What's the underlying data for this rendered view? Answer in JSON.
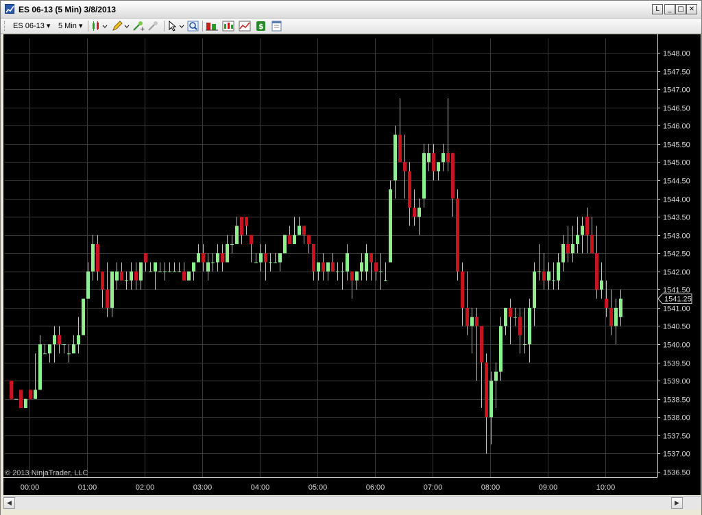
{
  "window": {
    "title": "ES 06-13 (5 Min)  3/8/2013",
    "buttons": {
      "link": "L",
      "minimize": "_",
      "maximize": "□",
      "close": "✕"
    }
  },
  "toolbar": {
    "instrument": "ES 06-13",
    "interval": "5 Min",
    "icons": [
      "bar-type-icon",
      "drawing-pencil-icon",
      "zoom-in-icon",
      "zoom-out-icon",
      "cursor-pointer-icon",
      "magnifier-icon",
      "data-box-icon",
      "indicators-icon",
      "strategies-icon",
      "dollar-icon",
      "properties-icon"
    ]
  },
  "chart": {
    "copyright": "© 2013 NinjaTrader, LLC",
    "current_price_label": "1541.25",
    "colors": {
      "background": "#000000",
      "grid": "#3a3a3a",
      "up": "#90ee90",
      "down": "#c8141e",
      "wick": "#c0c0c0",
      "axis_text": "#dcdcdc"
    }
  },
  "chart_data": {
    "type": "candlestick",
    "instrument": "ES 06-13",
    "interval": "5 Min",
    "date": "3/8/2013",
    "y_ticks": [
      "1536.50",
      "1537.00",
      "1537.50",
      "1538.00",
      "1538.50",
      "1539.00",
      "1539.50",
      "1540.00",
      "1540.50",
      "1541.00",
      "1541.50",
      "1542.00",
      "1542.50",
      "1543.00",
      "1543.50",
      "1544.00",
      "1544.50",
      "1545.00",
      "1545.50",
      "1546.00",
      "1546.50",
      "1547.00",
      "1547.50",
      "1548.00"
    ],
    "ylim": [
      1536.25,
      1548.25
    ],
    "x_ticks": [
      "00:00",
      "01:00",
      "02:00",
      "03:00",
      "04:00",
      "05:00",
      "06:00",
      "07:00",
      "08:00",
      "09:00",
      "10:00"
    ],
    "current_price": 1541.25,
    "candles": [
      [
        1539.0,
        1539.0,
        1538.5,
        1538.5
      ],
      [
        1538.5,
        1538.5,
        1538.5,
        1538.5
      ],
      [
        1538.75,
        1538.75,
        1538.25,
        1538.25
      ],
      [
        1538.25,
        1538.5,
        1538.25,
        1538.5
      ],
      [
        1538.75,
        1538.75,
        1538.5,
        1538.5
      ],
      [
        1538.5,
        1539.75,
        1538.5,
        1538.75
      ],
      [
        1538.75,
        1540.25,
        1538.75,
        1540.0
      ],
      [
        1539.75,
        1540.0,
        1539.75,
        1539.75
      ],
      [
        1539.75,
        1540.0,
        1539.5,
        1540.0
      ],
      [
        1540.0,
        1540.5,
        1539.5,
        1540.25
      ],
      [
        1540.25,
        1540.5,
        1539.75,
        1540.0
      ],
      [
        1540.0,
        1540.0,
        1539.75,
        1540.0
      ],
      [
        1539.75,
        1540.0,
        1539.5,
        1539.75
      ],
      [
        1539.75,
        1540.25,
        1539.75,
        1540.0
      ],
      [
        1540.0,
        1540.75,
        1539.75,
        1540.25
      ],
      [
        1540.25,
        1541.25,
        1540.25,
        1541.25
      ],
      [
        1541.25,
        1542.25,
        1541.25,
        1542.0
      ],
      [
        1542.0,
        1543.0,
        1541.75,
        1542.75
      ],
      [
        1542.75,
        1543.0,
        1541.75,
        1542.0
      ],
      [
        1542.0,
        1542.0,
        1541.0,
        1541.5
      ],
      [
        1541.5,
        1542.25,
        1540.75,
        1541.0
      ],
      [
        1541.0,
        1541.75,
        1540.75,
        1542.0
      ],
      [
        1541.75,
        1542.25,
        1541.5,
        1542.0
      ],
      [
        1542.0,
        1542.25,
        1541.75,
        1541.75
      ],
      [
        1541.75,
        1542.0,
        1541.5,
        1541.75
      ],
      [
        1541.75,
        1542.25,
        1541.5,
        1542.0
      ],
      [
        1542.0,
        1542.25,
        1541.5,
        1541.75
      ],
      [
        1541.75,
        1542.25,
        1541.5,
        1542.25
      ],
      [
        1542.5,
        1542.5,
        1542.0,
        1542.25
      ],
      [
        1542.0,
        1542.25,
        1542.0,
        1542.0
      ],
      [
        1542.0,
        1542.25,
        1541.5,
        1542.25
      ],
      [
        1542.0,
        1542.25,
        1542.0,
        1542.0
      ],
      [
        1542.0,
        1542.25,
        1541.75,
        1542.0
      ],
      [
        1542.0,
        1542.25,
        1542.0,
        1542.0
      ],
      [
        1542.0,
        1542.25,
        1542.0,
        1542.0
      ],
      [
        1542.0,
        1542.25,
        1542.0,
        1542.0
      ],
      [
        1542.0,
        1542.25,
        1541.75,
        1541.75
      ],
      [
        1541.75,
        1542.0,
        1541.75,
        1542.0
      ],
      [
        1542.0,
        1542.25,
        1541.75,
        1542.25
      ],
      [
        1542.25,
        1542.75,
        1542.25,
        1542.5
      ],
      [
        1542.5,
        1542.75,
        1542.0,
        1542.25
      ],
      [
        1542.0,
        1542.5,
        1541.75,
        1542.25
      ],
      [
        1542.25,
        1542.5,
        1542.0,
        1542.25
      ],
      [
        1542.25,
        1542.75,
        1542.0,
        1542.5
      ],
      [
        1542.5,
        1542.75,
        1542.0,
        1542.25
      ],
      [
        1542.25,
        1543.0,
        1542.25,
        1542.75
      ],
      [
        1542.75,
        1543.0,
        1542.5,
        1542.75
      ],
      [
        1542.75,
        1543.5,
        1542.75,
        1543.25
      ],
      [
        1543.5,
        1543.5,
        1542.75,
        1543.0
      ],
      [
        1543.5,
        1543.5,
        1543.0,
        1543.25
      ],
      [
        1543.0,
        1543.0,
        1542.25,
        1542.75
      ],
      [
        1542.25,
        1542.5,
        1542.25,
        1542.25
      ],
      [
        1542.25,
        1542.75,
        1542.0,
        1542.5
      ],
      [
        1542.5,
        1542.75,
        1541.75,
        1542.25
      ],
      [
        1542.25,
        1542.5,
        1542.0,
        1542.25
      ],
      [
        1542.25,
        1542.5,
        1542.25,
        1542.25
      ],
      [
        1542.25,
        1542.5,
        1542.0,
        1542.5
      ],
      [
        1542.5,
        1543.0,
        1542.5,
        1543.0
      ],
      [
        1543.0,
        1543.25,
        1542.75,
        1542.75
      ],
      [
        1542.75,
        1543.5,
        1542.75,
        1543.0
      ],
      [
        1543.0,
        1543.5,
        1543.0,
        1543.25
      ],
      [
        1543.25,
        1543.25,
        1542.75,
        1543.0
      ],
      [
        1543.0,
        1543.0,
        1542.5,
        1542.75
      ],
      [
        1542.75,
        1542.75,
        1541.75,
        1542.0
      ],
      [
        1542.0,
        1542.25,
        1541.75,
        1542.25
      ],
      [
        1542.25,
        1542.5,
        1541.75,
        1542.0
      ],
      [
        1542.0,
        1542.25,
        1541.75,
        1542.25
      ],
      [
        1542.25,
        1542.5,
        1542.0,
        1542.0
      ],
      [
        1542.0,
        1542.25,
        1541.75,
        1542.0
      ],
      [
        1542.0,
        1542.25,
        1541.5,
        1542.0
      ],
      [
        1542.0,
        1542.75,
        1541.75,
        1542.5
      ],
      [
        1542.0,
        1542.0,
        1541.25,
        1541.75
      ],
      [
        1541.75,
        1542.0,
        1541.5,
        1542.0
      ],
      [
        1542.0,
        1542.5,
        1541.75,
        1542.25
      ],
      [
        1542.0,
        1542.75,
        1541.75,
        1542.5
      ],
      [
        1542.5,
        1542.5,
        1541.75,
        1542.25
      ],
      [
        1542.25,
        1542.25,
        1541.75,
        1542.0
      ],
      [
        1542.0,
        1542.5,
        1541.5,
        1542.0
      ],
      [
        1541.75,
        1542.25,
        1541.75,
        1541.75
      ],
      [
        1542.25,
        1544.5,
        1542.25,
        1544.25
      ],
      [
        1544.5,
        1546.0,
        1544.0,
        1545.75
      ],
      [
        1545.75,
        1546.75,
        1545.0,
        1545.0
      ],
      [
        1545.0,
        1545.75,
        1544.0,
        1544.75
      ],
      [
        1544.75,
        1545.0,
        1543.25,
        1543.75
      ],
      [
        1543.75,
        1544.25,
        1543.25,
        1543.5
      ],
      [
        1543.5,
        1544.0,
        1543.0,
        1543.75
      ],
      [
        1544.0,
        1545.5,
        1543.75,
        1545.25
      ],
      [
        1545.0,
        1545.5,
        1544.75,
        1545.25
      ],
      [
        1545.25,
        1545.5,
        1544.5,
        1544.75
      ],
      [
        1544.75,
        1545.0,
        1544.5,
        1545.0
      ],
      [
        1545.0,
        1545.5,
        1544.75,
        1545.25
      ],
      [
        1545.25,
        1546.75,
        1544.75,
        1545.0
      ],
      [
        1545.25,
        1545.25,
        1543.5,
        1544.0
      ],
      [
        1544.0,
        1544.25,
        1541.75,
        1542.0
      ],
      [
        1542.0,
        1542.25,
        1540.5,
        1541.0
      ],
      [
        1541.0,
        1542.0,
        1540.25,
        1540.5
      ],
      [
        1540.5,
        1541.0,
        1539.75,
        1540.75
      ],
      [
        1540.75,
        1541.0,
        1539.0,
        1540.5
      ],
      [
        1540.5,
        1540.5,
        1538.25,
        1539.5
      ],
      [
        1539.5,
        1539.75,
        1537.0,
        1538.0
      ],
      [
        1538.0,
        1539.25,
        1537.25,
        1539.0
      ],
      [
        1539.0,
        1539.5,
        1538.25,
        1539.25
      ],
      [
        1539.25,
        1540.75,
        1539.0,
        1540.5
      ],
      [
        1540.5,
        1541.0,
        1540.25,
        1541.0
      ],
      [
        1541.0,
        1541.25,
        1540.0,
        1540.75
      ],
      [
        1540.75,
        1541.0,
        1540.5,
        1540.75
      ],
      [
        1540.75,
        1541.0,
        1539.75,
        1540.25
      ],
      [
        1540.0,
        1541.0,
        1539.75,
        1540.0
      ],
      [
        1540.0,
        1541.25,
        1539.5,
        1541.0
      ],
      [
        1541.0,
        1542.25,
        1540.5,
        1542.0
      ],
      [
        1542.0,
        1542.75,
        1541.75,
        1542.0
      ],
      [
        1542.0,
        1542.5,
        1541.5,
        1541.75
      ],
      [
        1541.75,
        1542.25,
        1541.5,
        1542.0
      ],
      [
        1541.75,
        1542.25,
        1541.5,
        1541.75
      ],
      [
        1541.75,
        1542.5,
        1541.5,
        1542.25
      ],
      [
        1542.25,
        1543.0,
        1542.0,
        1542.75
      ],
      [
        1542.75,
        1543.25,
        1542.25,
        1542.5
      ],
      [
        1542.5,
        1543.25,
        1542.25,
        1542.75
      ],
      [
        1542.75,
        1543.5,
        1542.5,
        1543.0
      ],
      [
        1543.0,
        1543.5,
        1542.5,
        1543.25
      ],
      [
        1543.5,
        1543.75,
        1542.5,
        1543.0
      ],
      [
        1543.0,
        1543.5,
        1542.75,
        1542.5
      ],
      [
        1542.5,
        1543.25,
        1541.25,
        1541.5
      ],
      [
        1541.5,
        1542.25,
        1541.25,
        1541.75
      ],
      [
        1541.25,
        1541.75,
        1540.75,
        1541.0
      ],
      [
        1541.0,
        1541.5,
        1540.25,
        1540.5
      ],
      [
        1540.5,
        1541.25,
        1540.0,
        1541.0
      ],
      [
        1540.75,
        1541.5,
        1540.5,
        1541.25
      ]
    ]
  }
}
